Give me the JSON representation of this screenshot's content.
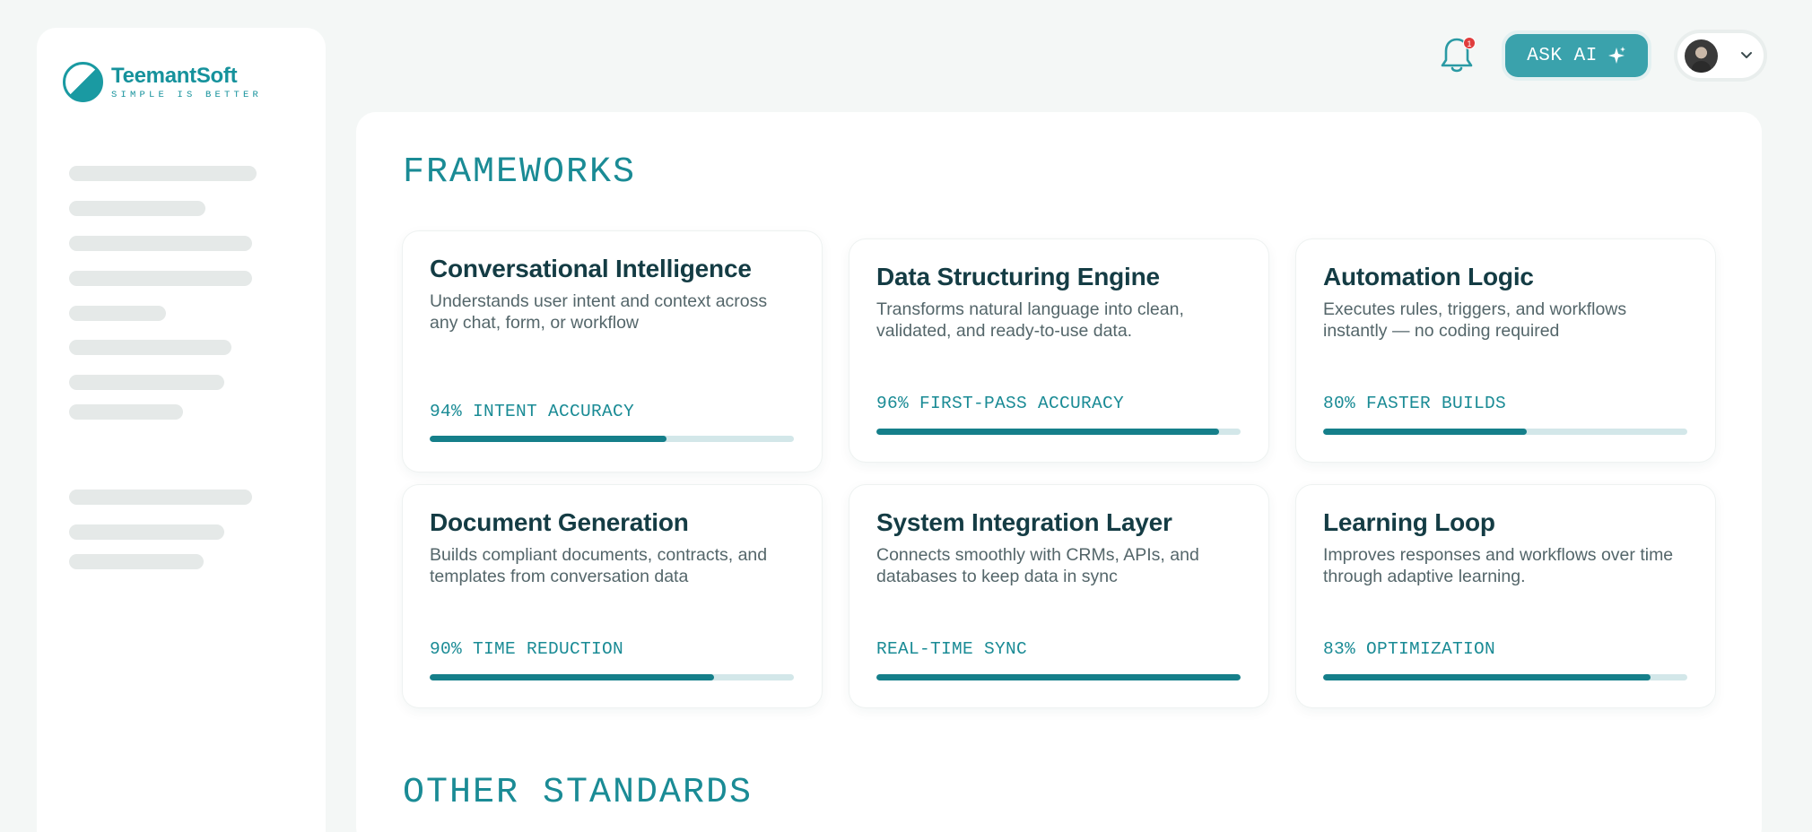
{
  "brand": {
    "name": "TeemantSoft",
    "tagline": "SIMPLE IS BETTER"
  },
  "topbar": {
    "notification_count": "1",
    "ask_ai_label": "ASK AI"
  },
  "sections": {
    "frameworks_title": "FRAMEWORKS",
    "other_title": "OTHER STANDARDS"
  },
  "cards": [
    {
      "title": "Conversational Intelligence",
      "desc": "Understands user intent and context across any chat, form, or workflow",
      "metric": "94% INTENT ACCURACY",
      "progress": 0.65
    },
    {
      "title": "Data Structuring Engine",
      "desc": "Transforms natural language into clean, validated, and ready-to-use data.",
      "metric": "96% FIRST-PASS ACCURACY",
      "progress": 0.94
    },
    {
      "title": "Automation Logic",
      "desc": "Executes rules, triggers, and workflows instantly — no coding required",
      "metric": "80% FASTER BUILDS",
      "progress": 0.56
    },
    {
      "title": "Document Generation",
      "desc": "Builds compliant documents, contracts, and templates from conversation data",
      "metric": "90% TIME REDUCTION",
      "progress": 0.78
    },
    {
      "title": "System Integration Layer",
      "desc": "Connects smoothly with CRMs, APIs, and databases to keep data in sync",
      "metric": "REAL-TIME SYNC",
      "progress": 1.0
    },
    {
      "title": "Learning Loop",
      "desc": "Improves responses and workflows over time through adaptive learning.",
      "metric": "83% OPTIMIZATION",
      "progress": 0.9
    }
  ],
  "colors": {
    "accent": "#1a8b95",
    "bar": "#157f8a",
    "track": "#d3e7e9",
    "badge": "#e03d3d"
  }
}
